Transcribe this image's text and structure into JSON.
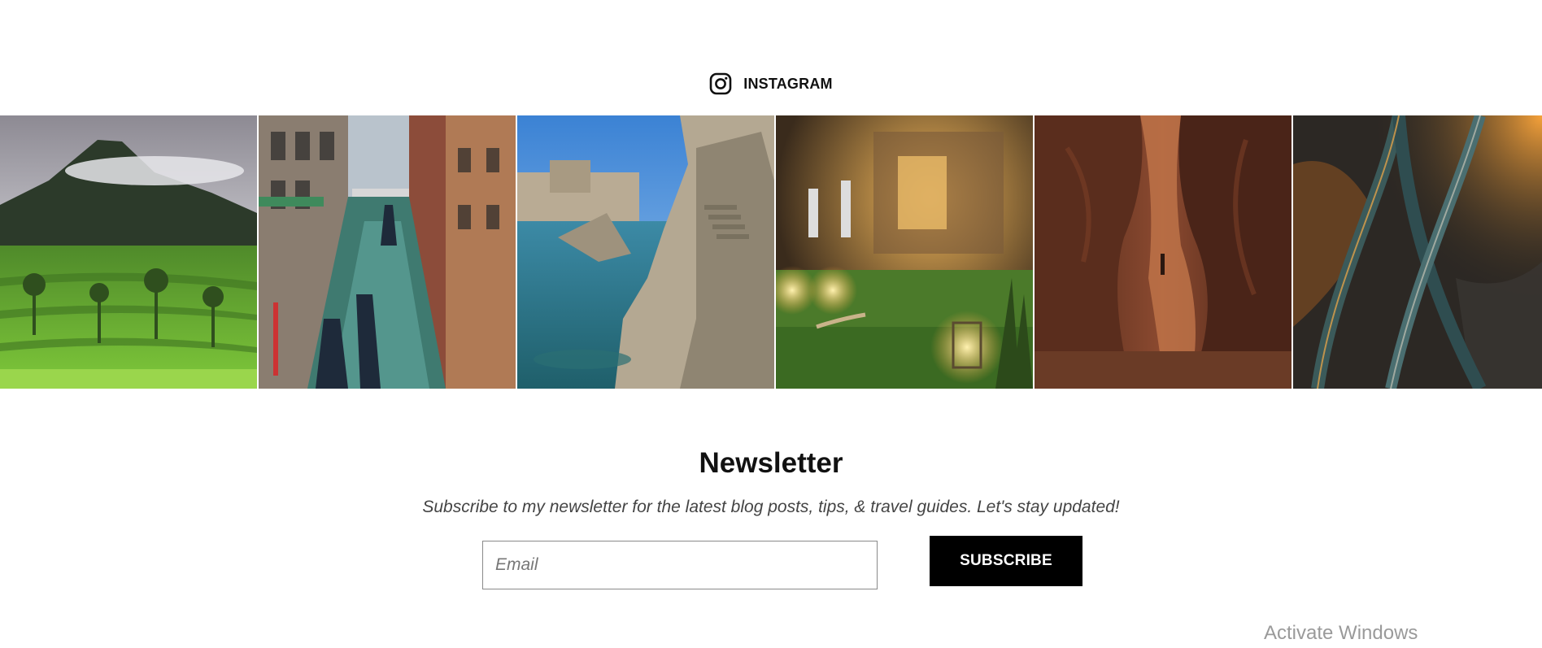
{
  "instagram": {
    "label": "INSTAGRAM",
    "icon": "instagram-icon"
  },
  "gallery": {
    "photos": [
      {
        "name": "photo-mountain-rice-terraces"
      },
      {
        "name": "photo-venice-canal"
      },
      {
        "name": "photo-coastal-fortress"
      },
      {
        "name": "photo-garden-lanterns"
      },
      {
        "name": "photo-slot-canyon"
      },
      {
        "name": "photo-aerial-highway"
      }
    ]
  },
  "newsletter": {
    "title": "Newsletter",
    "subtitle": "Subscribe to my newsletter for the latest blog posts, tips, & travel guides. Let's stay updated!",
    "email_placeholder": "Email",
    "subscribe_label": "SUBSCRIBE"
  },
  "watermark": {
    "text": "Activate Windows"
  },
  "colors": {
    "button_bg": "#000000",
    "button_text": "#ffffff",
    "input_border": "#8a8a8a",
    "subtitle": "#444444"
  }
}
